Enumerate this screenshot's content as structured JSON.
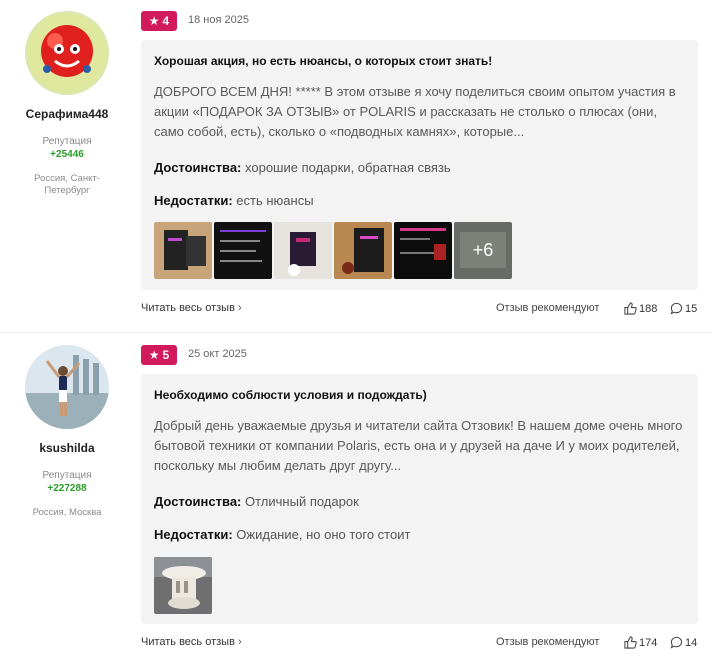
{
  "reviews": [
    {
      "user": {
        "name": "Серафима448",
        "reputation_label": "Репутация",
        "reputation": "+25446",
        "location": "Россия, Санкт-Петербург"
      },
      "rating": "4",
      "date": "18 ноя 2025",
      "title": "Хорошая акция, но есть нюансы, о которых стоит знать!",
      "text": "ДОБРОГО ВСЕМ ДНЯ! ***** В этом отзыве я хочу поделиться своим опытом участия в акции «ПОДАРОК ЗА ОТЗЫВ» от POLARIS и рассказать не столько о плюсах (они, само собой, есть), сколько о «подводных камнях», которые...",
      "pros_label": "Достоинства:",
      "pros": "хорошие подарки, обратная связь",
      "cons_label": "Недостатки:",
      "cons": "есть нюансы",
      "more_photos": "+6",
      "read_more": "Читать весь отзыв",
      "recommend": "Отзыв рекомендуют",
      "likes": "188",
      "comments": "15"
    },
    {
      "user": {
        "name": "ksushilda",
        "reputation_label": "Репутация",
        "reputation": "+227288",
        "location": "Россия, Москва"
      },
      "rating": "5",
      "date": "25 окт 2025",
      "title": "Необходимо соблюсти условия и подождать)",
      "text": "Добрый день уважаемые друзья и читатели сайта Отзовик! В нашем доме очень много бытовой техники от компании Polaris, есть она и у друзей на даче И у моих родителей, поскольку мы любим делать друг другу...",
      "pros_label": "Достоинства:",
      "pros": "Отличный подарок",
      "cons_label": "Недостатки:",
      "cons": "Ожидание, но оно того стоит",
      "read_more": "Читать весь отзыв",
      "recommend": "Отзыв рекомендуют",
      "likes": "174",
      "comments": "14"
    }
  ],
  "colors": {
    "rating_badge": "#d1195b",
    "reputation": "#2a9d2a",
    "card_bg": "#f3f3f3"
  },
  "icons": [
    "star-icon",
    "chevron-right-icon",
    "thumbs-up-icon",
    "comment-icon"
  ]
}
